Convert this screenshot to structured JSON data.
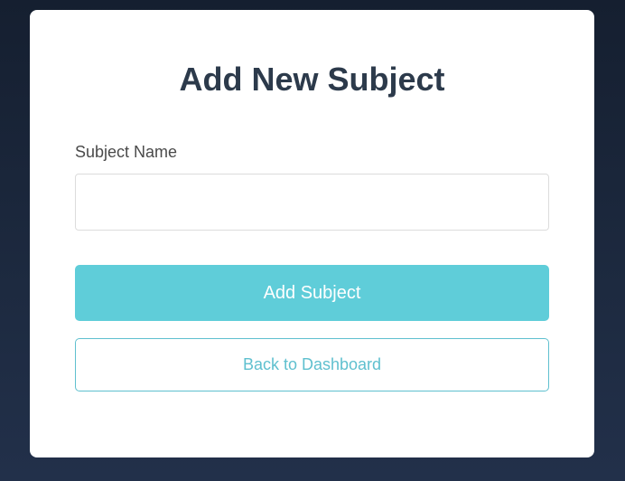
{
  "form": {
    "title": "Add New Subject",
    "subject_name_label": "Subject Name",
    "subject_name_value": "",
    "subject_name_placeholder": "",
    "submit_label": "Add Subject",
    "back_label": "Back to Dashboard"
  },
  "colors": {
    "background": "#1b263a",
    "card": "#ffffff",
    "title": "#2c3a4b",
    "accent": "#5fcdd9",
    "outline_accent": "#5fc0cf"
  }
}
